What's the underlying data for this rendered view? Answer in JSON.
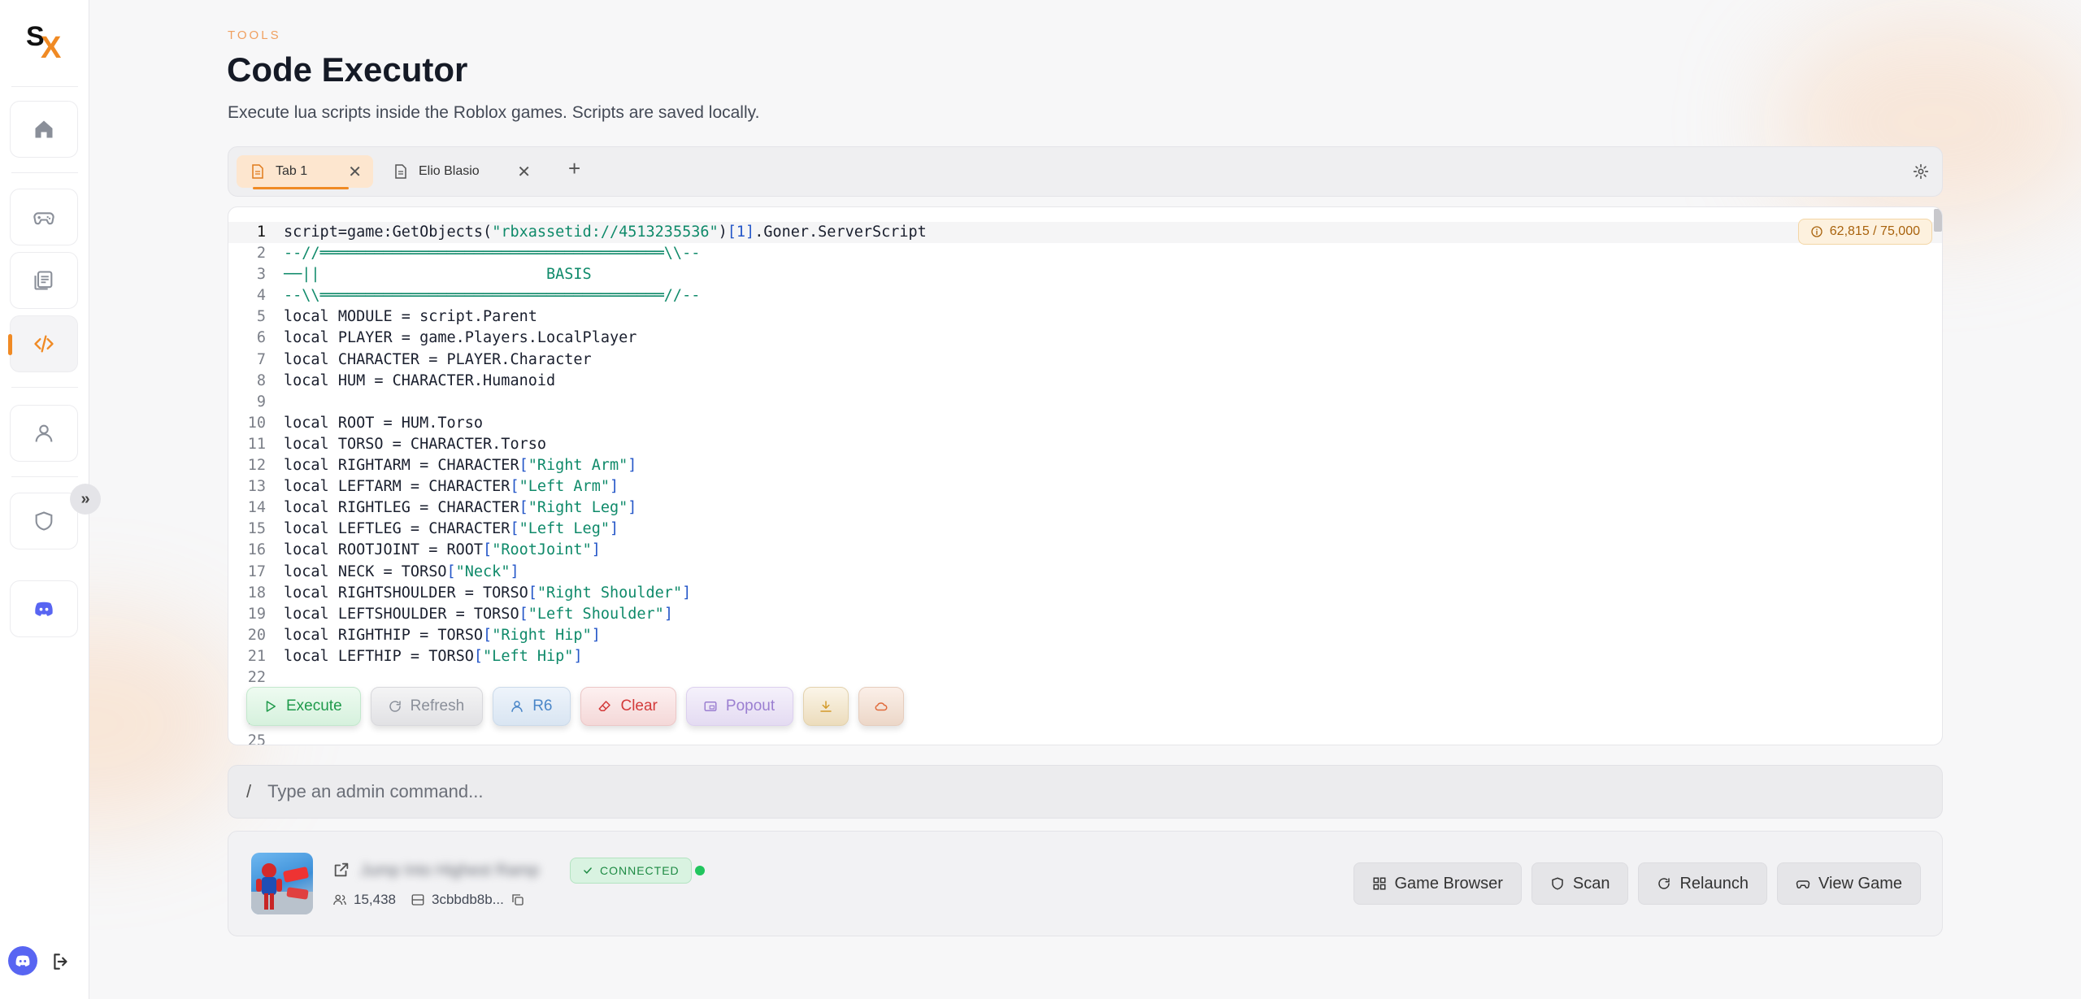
{
  "app": {
    "logo_s": "S",
    "logo_x": "X"
  },
  "sidebar": {
    "items": [
      {
        "name": "home",
        "icon": "home-icon"
      },
      {
        "name": "games",
        "icon": "gamepad-icon"
      },
      {
        "name": "scripts",
        "icon": "library-icon"
      },
      {
        "name": "executor",
        "icon": "code-icon",
        "active": true
      },
      {
        "name": "account",
        "icon": "user-icon"
      },
      {
        "name": "security",
        "icon": "shield-icon"
      },
      {
        "name": "discord",
        "icon": "discord-icon"
      }
    ],
    "expand_label": "»"
  },
  "header": {
    "eyebrow": "TOOLS",
    "title": "Code Executor",
    "subtitle": "Execute lua scripts inside the Roblox games. Scripts are saved locally."
  },
  "tabs": [
    {
      "label": "Tab 1",
      "active": true
    },
    {
      "label": "Elio Blasio",
      "active": false
    }
  ],
  "tab_add_label": "+",
  "tab_close_label": "✕",
  "editor": {
    "char_counter": "62,815 / 75,000",
    "current_line": 1,
    "lines": [
      "script=game:GetObjects(\"rbxassetid://4513235536\")[1].Goner.ServerScript",
      "--//══════════════════════════════════════\\\\--",
      "──||                         BASIS",
      "--\\\\══════════════════════════════════════//--",
      "local MODULE = script.Parent",
      "local PLAYER = game.Players.LocalPlayer",
      "local CHARACTER = PLAYER.Character",
      "local HUM = CHARACTER.Humanoid",
      "",
      "local ROOT = HUM.Torso",
      "local TORSO = CHARACTER.Torso",
      "local RIGHTARM = CHARACTER[\"Right Arm\"]",
      "local LEFTARM = CHARACTER[\"Left Arm\"]",
      "local RIGHTLEG = CHARACTER[\"Right Leg\"]",
      "local LEFTLEG = CHARACTER[\"Left Leg\"]",
      "local ROOTJOINT = ROOT[\"RootJoint\"]",
      "local NECK = TORSO[\"Neck\"]",
      "local RIGHTSHOULDER = TORSO[\"Right Shoulder\"]",
      "local LEFTSHOULDER = TORSO[\"Left Shoulder\"]",
      "local RIGHTHIP = TORSO[\"Right Hip\"]",
      "local LEFTHIP = TORSO[\"Left Hip\"]",
      "",
      "",
      "",
      ""
    ]
  },
  "actions": {
    "execute": "Execute",
    "refresh": "Refresh",
    "r6": "R6",
    "clear": "Clear",
    "popout": "Popout"
  },
  "command": {
    "slash": "/",
    "placeholder": "Type an admin command..."
  },
  "game": {
    "name": "Jump Into Highest Ramp",
    "status": "CONNECTED",
    "players": "15,438",
    "server_id": "3cbbdb8b..."
  },
  "game_buttons": {
    "browser": "Game Browser",
    "scan": "Scan",
    "relaunch": "Relaunch",
    "view": "View Game"
  },
  "colors": {
    "accent": "#f08a24",
    "connected": "#22c55e",
    "string": "#0f8a6a",
    "number": "#2456c8"
  }
}
